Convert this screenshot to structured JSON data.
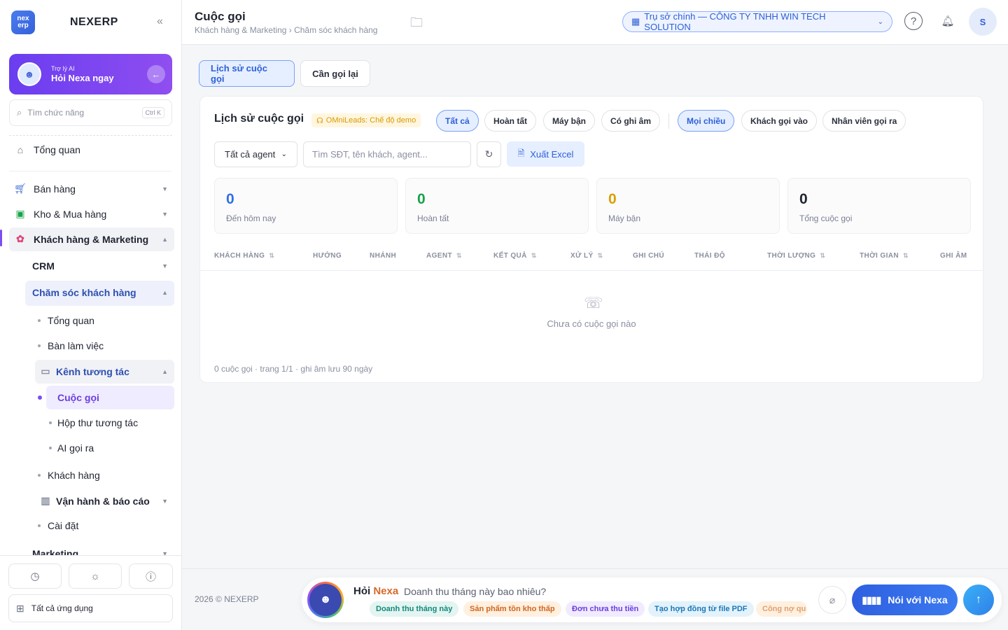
{
  "brand": {
    "logo_top": "nex",
    "logo_bottom": "erp",
    "name": "NEXERP",
    "collapse_icon": "«"
  },
  "ai": {
    "small": "Trợ lý AI",
    "big": "Hỏi Nexa ngay"
  },
  "search": {
    "placeholder": "Tìm chức năng",
    "shortcut": "Ctrl K"
  },
  "nav": {
    "overview": "Tổng quan",
    "sales": "Bán hàng",
    "inventory": "Kho & Mua hàng",
    "crm_marketing": "Khách hàng & Marketing",
    "crm": "CRM",
    "care": "Chăm sóc khách hàng",
    "care_overview": "Tổng quan",
    "workspace": "Bàn làm việc",
    "channels": "Kênh tương tác",
    "calls": "Cuộc gọi",
    "inbox": "Hộp thư tương tác",
    "ai_call": "AI gọi ra",
    "customers": "Khách hàng",
    "ops": "Vận hành & báo cáo",
    "settings": "Cài đặt",
    "marketing": "Marketing"
  },
  "bottom": {
    "all_apps": "Tất cả ứng dụng"
  },
  "header": {
    "title": "Cuộc gọi",
    "breadcrumb": "Khách hàng & Marketing › Chăm sóc khách hàng",
    "branch": "Trụ sở chính — CÔNG TY TNHH WIN TECH SOLUTION",
    "avatar": "S"
  },
  "tabs": [
    "Lịch sử cuộc gọi",
    "Cần gọi lại"
  ],
  "card": {
    "title": "Lịch sử cuộc gọi",
    "demo": "OMniLeads: Chế độ demo",
    "status_chips": [
      "Tất cả",
      "Hoàn tất",
      "Máy bận",
      "Có ghi âm"
    ],
    "direction_chips": [
      "Mọi chiều",
      "Khách gọi vào",
      "Nhân viên gọi ra"
    ],
    "agent_select": "Tất cả agent",
    "search_placeholder": "Tìm SĐT, tên khách, agent...",
    "export": "Xuất Excel",
    "stats": [
      {
        "value": "0",
        "label": "Đến hôm nay",
        "color": "#2f6fe8"
      },
      {
        "value": "0",
        "label": "Hoàn tất",
        "color": "#16a34a"
      },
      {
        "value": "0",
        "label": "Máy bận",
        "color": "#d9a000"
      },
      {
        "value": "0",
        "label": "Tổng cuộc gọi",
        "color": "#1f2430"
      }
    ],
    "columns": [
      "KHÁCH HÀNG",
      "HƯỚNG",
      "NHÁNH",
      "AGENT",
      "KẾT QUẢ",
      "XỬ LÝ",
      "GHI CHÚ",
      "THÁI ĐỘ",
      "THỜI LƯỢNG",
      "THỜI GIAN",
      "GHI ÂM"
    ],
    "empty": "Chưa có cuộc gọi nào",
    "footnote": "0 cuộc gọi · trang 1/1 · ghi âm lưu 90 ngày"
  },
  "footer": {
    "copyright": "2026 © NEXERP",
    "ask_prefix": "Hỏi",
    "ask_name": "Nexa",
    "question": "Doanh thu tháng này bao nhiêu?",
    "suggestions": [
      "Doanh thu tháng này",
      "Sản phẩm tồn kho thấp",
      "Đơn chưa thu tiền",
      "Tạo hợp đồng từ file PDF",
      "Công nợ qu"
    ],
    "talk": "Nói với Nexa"
  }
}
